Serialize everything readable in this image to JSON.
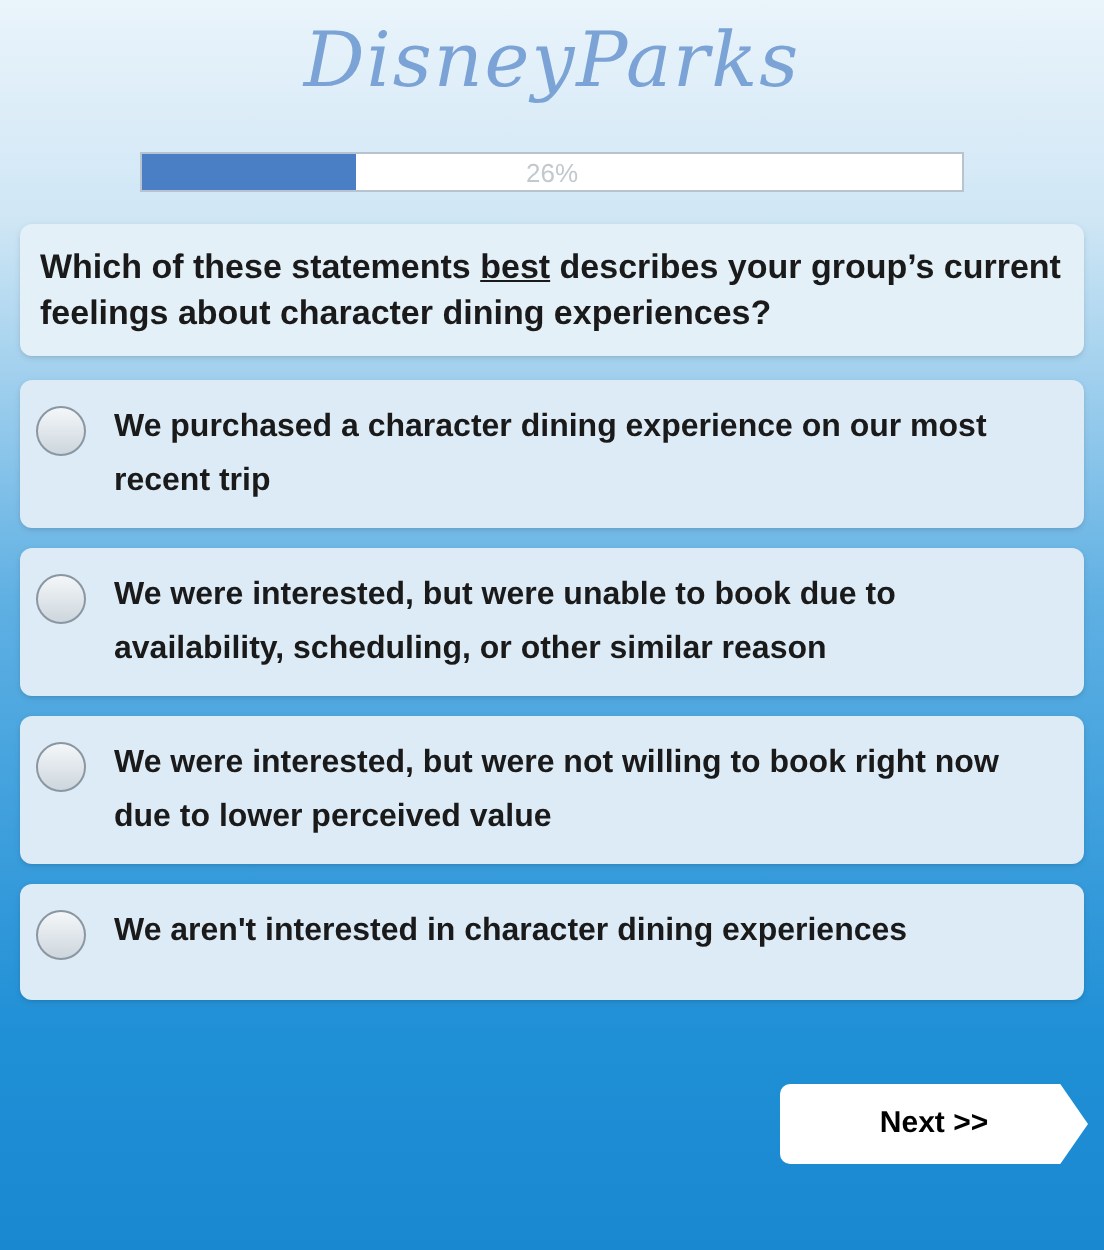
{
  "logo": {
    "text": "DisneyParks"
  },
  "progress": {
    "level": 0.26,
    "label": "26%"
  },
  "question": {
    "text": "Which of these statements **best** describes your group’s current feelings about character dining experiences?"
  },
  "options": [
    {
      "label": "We purchased a character dining experience on our most recent trip",
      "selected": false
    },
    {
      "label": "We were interested, but were unable to book due to availability, scheduling, or other similar reason",
      "selected": false
    },
    {
      "label": "We were interested, but were not willing to book right now due to lower perceived value",
      "selected": false
    },
    {
      "label": "We aren't interested in character dining experiences",
      "selected": false
    }
  ],
  "next_button": {
    "label": "Next >>"
  }
}
